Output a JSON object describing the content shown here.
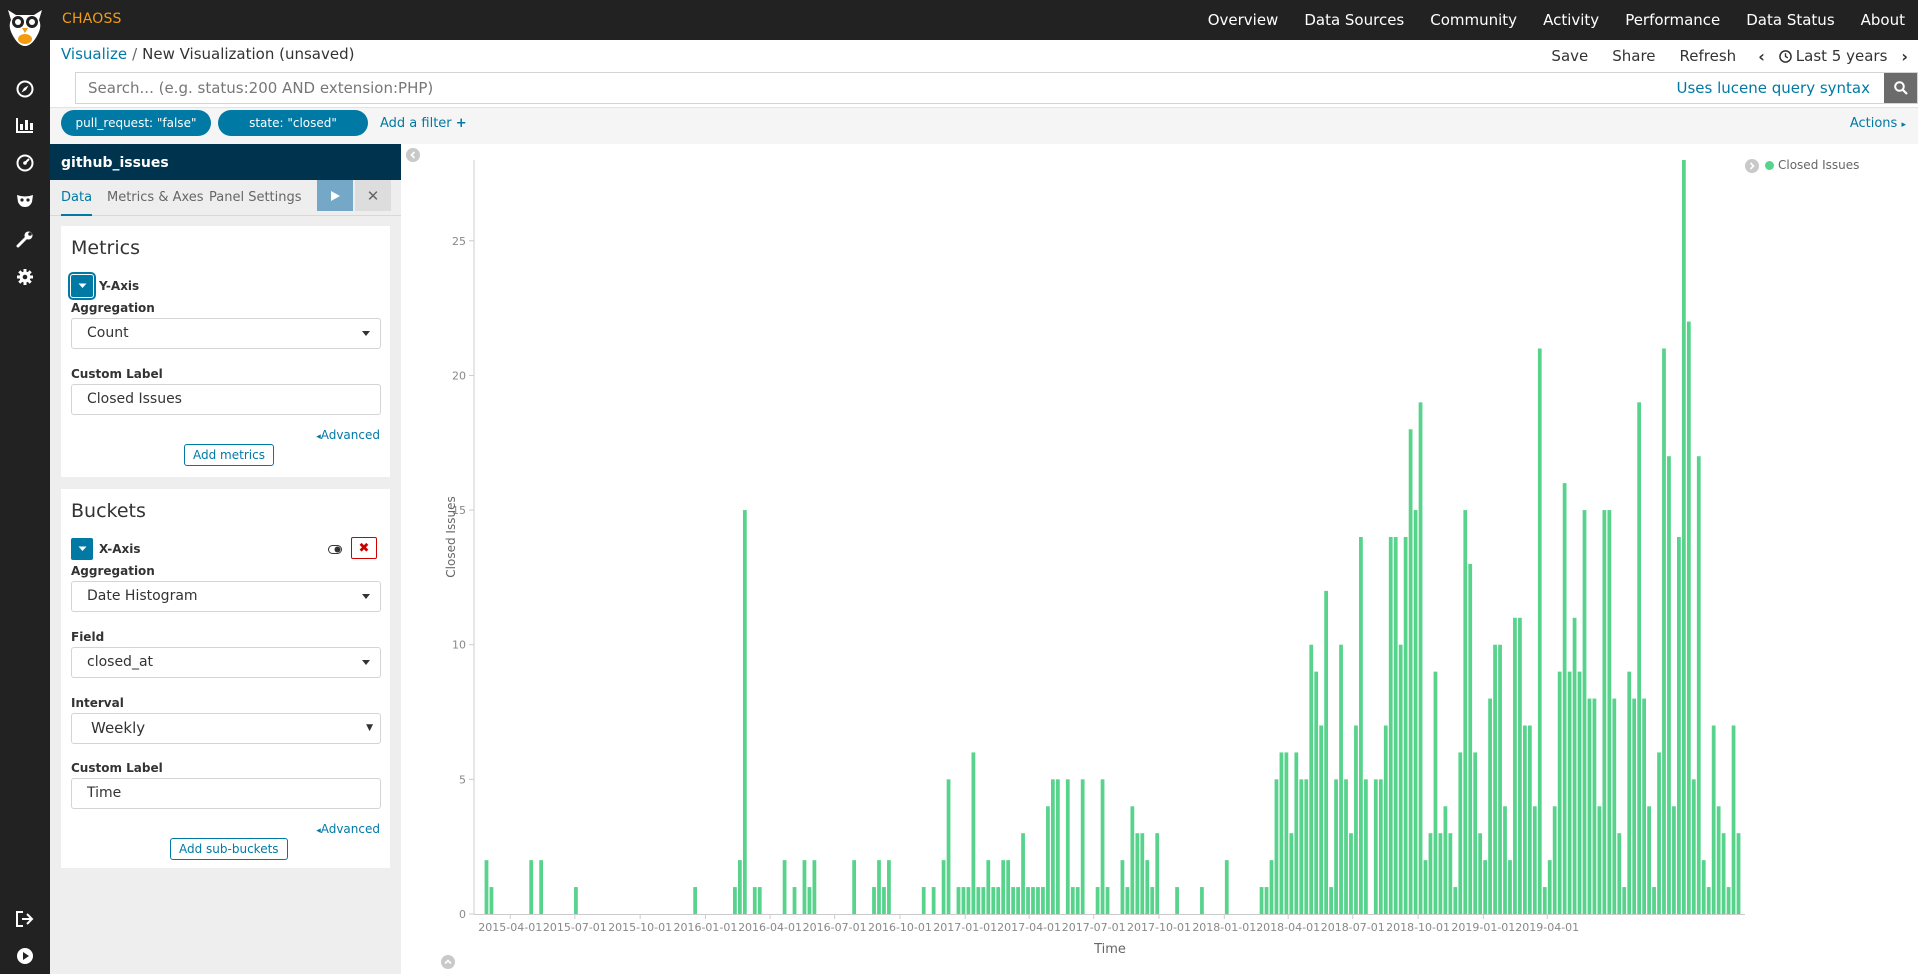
{
  "topbar": {
    "brand": "CHAOSS",
    "nav": [
      "Overview",
      "Data Sources",
      "Community",
      "Activity",
      "Performance",
      "Data Status",
      "About"
    ]
  },
  "breadcrumb": {
    "root": "Visualize",
    "current": "New Visualization (unsaved)"
  },
  "toolbar": {
    "save": "Save",
    "share": "Share",
    "refresh": "Refresh",
    "time_range": "Last 5 years"
  },
  "search": {
    "placeholder": "Search... (e.g. status:200 AND extension:PHP)",
    "syntax_link": "Uses lucene query syntax"
  },
  "filters": {
    "pills": [
      "pull_request: \"false\"",
      "state: \"closed\""
    ],
    "add_label": "Add a filter",
    "actions_label": "Actions"
  },
  "sidebar": {
    "index_name": "github_issues",
    "tabs": [
      "Data",
      "Metrics & Axes",
      "Panel Settings"
    ],
    "metrics": {
      "title": "Metrics",
      "y_axis_label": "Y-Axis",
      "aggregation_label": "Aggregation",
      "aggregation_value": "Count",
      "custom_label_label": "Custom Label",
      "custom_label_value": "Closed Issues",
      "advanced": "Advanced",
      "add_button": "Add metrics"
    },
    "buckets": {
      "title": "Buckets",
      "x_axis_label": "X-Axis",
      "aggregation_label": "Aggregation",
      "aggregation_value": "Date Histogram",
      "field_label": "Field",
      "field_value": "closed_at",
      "interval_label": "Interval",
      "interval_value": "Weekly",
      "custom_label_label": "Custom Label",
      "custom_label_value": "Time",
      "advanced": "Advanced",
      "add_button": "Add sub-buckets"
    }
  },
  "colors": {
    "bar": "#57d38c",
    "accent": "#0079a5",
    "brand": "#f39c12",
    "index_header": "#00334d"
  },
  "chart_data": {
    "type": "bar",
    "xlabel": "Time",
    "ylabel": "Closed Issues",
    "legend": {
      "label": "Closed Issues",
      "placement": "top-right"
    },
    "ylim": [
      0,
      28
    ],
    "yticks": [
      0,
      5,
      10,
      15,
      20,
      25
    ],
    "xticks": [
      "2015-04-01",
      "2015-07-01",
      "2015-10-01",
      "2016-01-01",
      "2016-04-01",
      "2016-07-01",
      "2016-10-01",
      "2017-01-01",
      "2017-04-01",
      "2017-07-01",
      "2017-10-01",
      "2018-01-01",
      "2018-04-01",
      "2018-07-01",
      "2018-10-01",
      "2019-01-01",
      "2019-04-01"
    ],
    "xstart": "2015-02-23",
    "interval_days": 7,
    "values": [
      2,
      1,
      0,
      0,
      0,
      0,
      0,
      0,
      0,
      2,
      0,
      2,
      0,
      0,
      0,
      0,
      0,
      0,
      1,
      0,
      0,
      0,
      0,
      0,
      0,
      0,
      0,
      0,
      0,
      0,
      0,
      0,
      0,
      0,
      0,
      0,
      0,
      0,
      0,
      0,
      0,
      0,
      1,
      0,
      0,
      0,
      0,
      0,
      0,
      0,
      1,
      2,
      15,
      0,
      1,
      1,
      0,
      0,
      0,
      0,
      2,
      0,
      1,
      0,
      2,
      1,
      2,
      0,
      0,
      0,
      0,
      0,
      0,
      0,
      2,
      0,
      0,
      0,
      1,
      2,
      1,
      2,
      0,
      0,
      0,
      0,
      0,
      0,
      1,
      0,
      1,
      0,
      2,
      5,
      0,
      1,
      1,
      1,
      6,
      1,
      1,
      2,
      1,
      1,
      2,
      2,
      1,
      1,
      3,
      1,
      1,
      1,
      1,
      4,
      5,
      5,
      0,
      5,
      1,
      1,
      5,
      0,
      0,
      1,
      5,
      1,
      0,
      0,
      2,
      1,
      4,
      3,
      3,
      2,
      1,
      3,
      0,
      0,
      0,
      1,
      0,
      0,
      0,
      0,
      1,
      0,
      0,
      0,
      0,
      2,
      0,
      0,
      0,
      0,
      0,
      0,
      1,
      1,
      2,
      5,
      6,
      6,
      3,
      6,
      5,
      5,
      10,
      9,
      7,
      12,
      1,
      5,
      10,
      5,
      3,
      7,
      14,
      5,
      0,
      5,
      5,
      7,
      14,
      14,
      10,
      14,
      18,
      15,
      19,
      2,
      3,
      9,
      3,
      4,
      3,
      1,
      6,
      15,
      13,
      6,
      3,
      2,
      8,
      10,
      10,
      4,
      2,
      11,
      11,
      7,
      7,
      4,
      21,
      1,
      2,
      4,
      9,
      16,
      9,
      11,
      9,
      15,
      8,
      8,
      4,
      15,
      15,
      8,
      3,
      1,
      9,
      8,
      19,
      8,
      4,
      1,
      6,
      21,
      17,
      4,
      14,
      28,
      22,
      5,
      17,
      2,
      1,
      7,
      4,
      3,
      1,
      7,
      3
    ]
  }
}
